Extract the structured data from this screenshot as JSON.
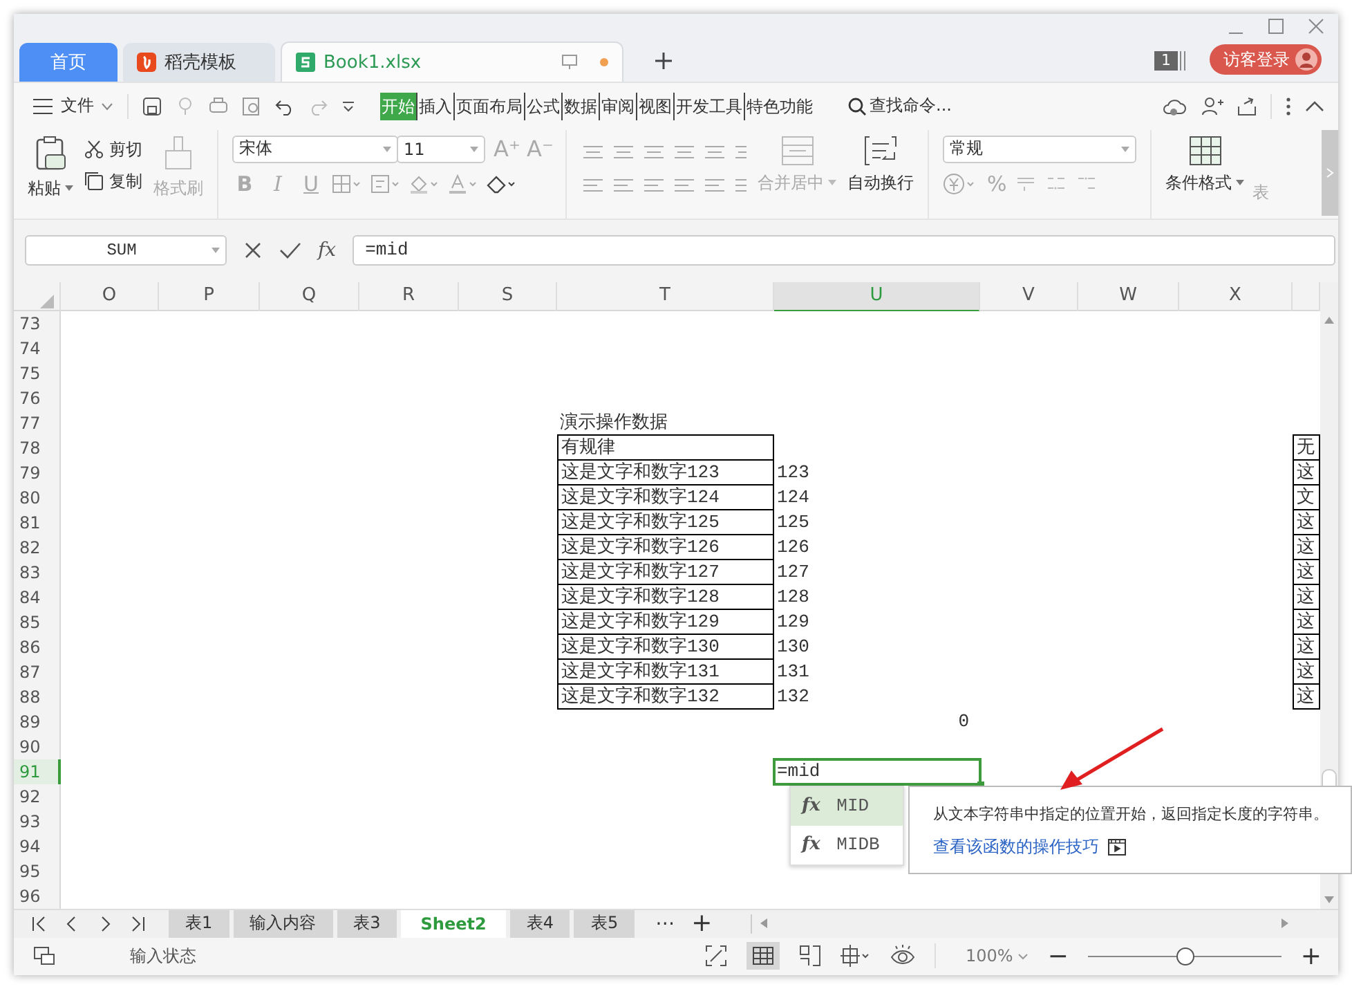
{
  "title_tabs": [
    {
      "label": "首页",
      "kind": "home",
      "selected": false,
      "unsaved": false
    },
    {
      "label": "稻壳模板",
      "kind": "docer",
      "selected": false,
      "unsaved": false
    },
    {
      "label": "Book1.xlsx",
      "kind": "sheet",
      "selected": true,
      "unsaved": true
    }
  ],
  "notification_count": "1",
  "login_button": "访客登录",
  "file_menu": "文件",
  "ribbon_tabs": [
    {
      "label": "开始",
      "selected": true
    },
    {
      "label": "插入",
      "selected": false
    },
    {
      "label": "页面布局",
      "selected": false
    },
    {
      "label": "公式",
      "selected": false
    },
    {
      "label": "数据",
      "selected": false
    },
    {
      "label": "审阅",
      "selected": false
    },
    {
      "label": "视图",
      "selected": false
    },
    {
      "label": "开发工具",
      "selected": false
    },
    {
      "label": "特色功能",
      "selected": false
    }
  ],
  "search_commands": "查找命令...",
  "clipboard": {
    "paste": "粘贴",
    "cut": "剪切",
    "copy": "复制",
    "format_painter": {
      "label": "格式刷",
      "disabled": true
    }
  },
  "font": {
    "name": "宋体",
    "size": "11",
    "grow": "A⁺",
    "shrink": "A⁻",
    "bold": "B",
    "italic": "I",
    "underline": "U"
  },
  "alignment": {
    "merge": {
      "label": "合并居中",
      "disabled": true
    },
    "wrap": {
      "label": "自动换行",
      "disabled": false
    }
  },
  "number_format": {
    "value": "常规",
    "percent": "%"
  },
  "styles": {
    "conditional": "条件格式",
    "table": "表"
  },
  "formula_bar": {
    "name_box": "SUM",
    "fx": "fx",
    "formula": "=mid"
  },
  "sheet": {
    "columns": [
      {
        "label": "O",
        "selected": false
      },
      {
        "label": "P",
        "selected": false
      },
      {
        "label": "Q",
        "selected": false
      },
      {
        "label": "R",
        "selected": false
      },
      {
        "label": "S",
        "selected": false
      },
      {
        "label": "T",
        "selected": false
      },
      {
        "label": "U",
        "selected": true
      },
      {
        "label": "V",
        "selected": false
      },
      {
        "label": "W",
        "selected": false
      },
      {
        "label": "X",
        "selected": false
      }
    ],
    "rows": [
      {
        "number": "73",
        "selected": false
      },
      {
        "number": "74",
        "selected": false
      },
      {
        "number": "75",
        "selected": false
      },
      {
        "number": "76",
        "selected": false
      },
      {
        "number": "77",
        "selected": false,
        "T": {
          "text": "演示操作数据",
          "boxed": false
        }
      },
      {
        "number": "78",
        "selected": false,
        "T": {
          "text": "有规律",
          "boxed": true
        },
        "edge": {
          "text": "无",
          "boxed": true
        }
      },
      {
        "number": "79",
        "selected": false,
        "T": {
          "text": "这是文字和数字123",
          "boxed": true
        },
        "U": {
          "text": "123",
          "boxed": false
        },
        "edge": {
          "text": "这",
          "boxed": true
        }
      },
      {
        "number": "80",
        "selected": false,
        "T": {
          "text": "这是文字和数字124",
          "boxed": true
        },
        "U": {
          "text": "124",
          "boxed": false
        },
        "edge": {
          "text": "文",
          "boxed": true
        }
      },
      {
        "number": "81",
        "selected": false,
        "T": {
          "text": "这是文字和数字125",
          "boxed": true
        },
        "U": {
          "text": "125",
          "boxed": false
        },
        "edge": {
          "text": "这",
          "boxed": true
        }
      },
      {
        "number": "82",
        "selected": false,
        "T": {
          "text": "这是文字和数字126",
          "boxed": true
        },
        "U": {
          "text": "126",
          "boxed": false
        },
        "edge": {
          "text": "这",
          "boxed": true
        }
      },
      {
        "number": "83",
        "selected": false,
        "T": {
          "text": "这是文字和数字127",
          "boxed": true
        },
        "U": {
          "text": "127",
          "boxed": false
        },
        "edge": {
          "text": "这",
          "boxed": true
        }
      },
      {
        "number": "84",
        "selected": false,
        "T": {
          "text": "这是文字和数字128",
          "boxed": true
        },
        "U": {
          "text": "128",
          "boxed": false
        },
        "edge": {
          "text": "这",
          "boxed": true
        }
      },
      {
        "number": "85",
        "selected": false,
        "T": {
          "text": "这是文字和数字129",
          "boxed": true
        },
        "U": {
          "text": "129",
          "boxed": false
        },
        "edge": {
          "text": "这",
          "boxed": true
        }
      },
      {
        "number": "86",
        "selected": false,
        "T": {
          "text": "这是文字和数字130",
          "boxed": true
        },
        "U": {
          "text": "130",
          "boxed": false
        },
        "edge": {
          "text": "这",
          "boxed": true
        }
      },
      {
        "number": "87",
        "selected": false,
        "T": {
          "text": "这是文字和数字131",
          "boxed": true
        },
        "U": {
          "text": "131",
          "boxed": false
        },
        "edge": {
          "text": "这",
          "boxed": true
        }
      },
      {
        "number": "88",
        "selected": false,
        "T": {
          "text": "这是文字和数字132",
          "boxed": true
        },
        "U": {
          "text": "132",
          "boxed": false
        },
        "edge": {
          "text": "这",
          "boxed": true
        }
      },
      {
        "number": "89",
        "selected": false,
        "U": {
          "text": "0",
          "boxed": false,
          "right_aligned": true
        }
      },
      {
        "number": "90",
        "selected": false
      },
      {
        "number": "91",
        "selected": true,
        "U": {
          "text": "=mid",
          "boxed": false,
          "active": true
        }
      },
      {
        "number": "92",
        "selected": false
      },
      {
        "number": "93",
        "selected": false
      },
      {
        "number": "94",
        "selected": false
      },
      {
        "number": "95",
        "selected": false
      },
      {
        "number": "96",
        "selected": false
      }
    ]
  },
  "autocomplete": [
    {
      "icon": "fx",
      "name": "MID",
      "selected": true
    },
    {
      "icon": "fx",
      "name": "MIDB",
      "selected": false
    }
  ],
  "function_tip": {
    "description": "从文本字符串中指定的位置开始，返回指定长度的字符串。",
    "link": "查看该函数的操作技巧"
  },
  "sheet_tabs": [
    {
      "label": "表1",
      "selected": false
    },
    {
      "label": "输入内容",
      "selected": false
    },
    {
      "label": "表3",
      "selected": false
    },
    {
      "label": "Sheet2",
      "selected": true
    },
    {
      "label": "表4",
      "selected": false
    },
    {
      "label": "表5",
      "selected": false
    }
  ],
  "sheet_more": "⋯",
  "sheet_add": "+",
  "status_bar": {
    "mode": "输入状态",
    "zoom": "100%",
    "minus": "−",
    "plus": "+",
    "zoom_slider": {
      "level": 0.5
    }
  }
}
